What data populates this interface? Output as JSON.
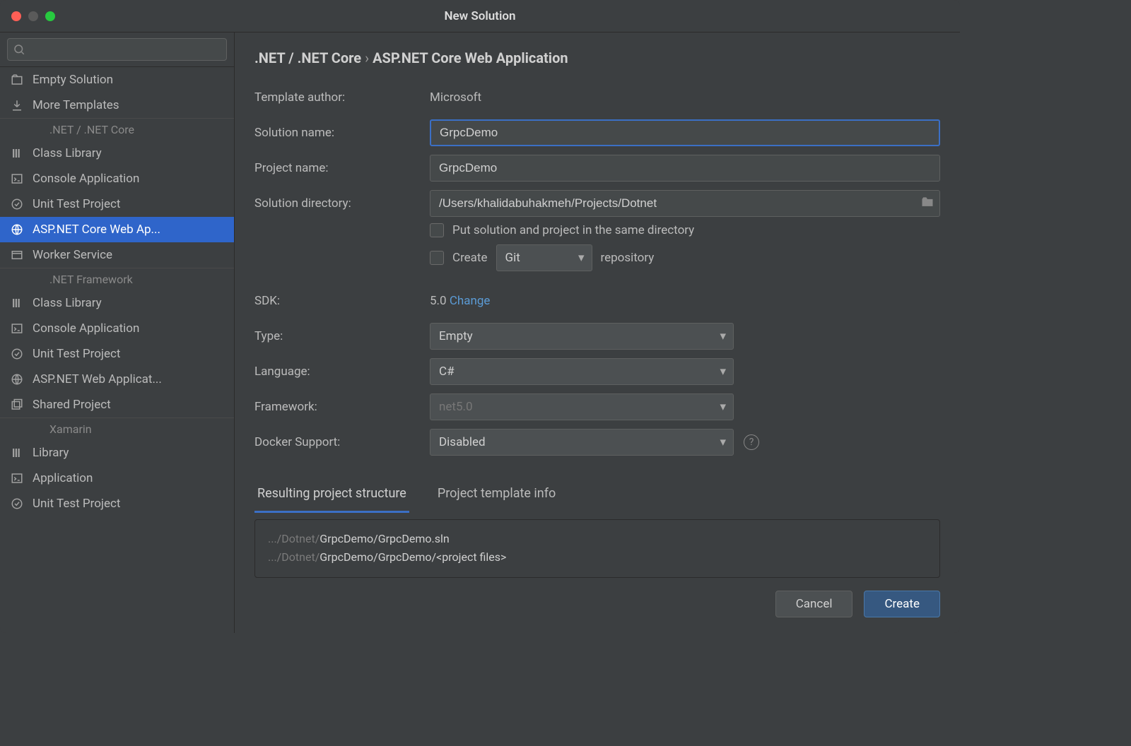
{
  "title": "New Solution",
  "search": {
    "placeholder": ""
  },
  "sidebar": {
    "top": [
      {
        "label": "Empty Solution",
        "icon": "empty-solution"
      },
      {
        "label": "More Templates",
        "icon": "download"
      }
    ],
    "sections": [
      {
        "name": ".NET / .NET Core",
        "items": [
          {
            "label": "Class Library",
            "icon": "library"
          },
          {
            "label": "Console Application",
            "icon": "console"
          },
          {
            "label": "Unit Test Project",
            "icon": "test"
          },
          {
            "label": "ASP.NET Core Web Ap...",
            "icon": "globe",
            "selected": true
          },
          {
            "label": "Worker Service",
            "icon": "window"
          }
        ]
      },
      {
        "name": ".NET Framework",
        "items": [
          {
            "label": "Class Library",
            "icon": "library"
          },
          {
            "label": "Console Application",
            "icon": "console"
          },
          {
            "label": "Unit Test Project",
            "icon": "test"
          },
          {
            "label": "ASP.NET Web Applicat...",
            "icon": "globe"
          },
          {
            "label": "Shared Project",
            "icon": "shared"
          }
        ]
      },
      {
        "name": "Xamarin",
        "items": [
          {
            "label": "Library",
            "icon": "library"
          },
          {
            "label": "Application",
            "icon": "console"
          },
          {
            "label": "Unit Test Project",
            "icon": "test"
          }
        ]
      }
    ]
  },
  "breadcrumb": {
    "section": ".NET / .NET Core",
    "page": "ASP.NET Core Web Application"
  },
  "form": {
    "template_author_label": "Template author:",
    "template_author": "Microsoft",
    "solution_name_label": "Solution name:",
    "solution_name": "GrpcDemo",
    "project_name_label": "Project name:",
    "project_name": "GrpcDemo",
    "solution_dir_label": "Solution directory:",
    "solution_dir": "/Users/khalidabuhakmeh/Projects/Dotnet",
    "same_dir_label": "Put solution and project in the same directory",
    "create_label": "Create",
    "git": "Git",
    "repo_label": "repository",
    "sdk_label": "SDK:",
    "sdk_value": "5.0",
    "sdk_change": "Change",
    "type_label": "Type:",
    "type_value": "Empty",
    "language_label": "Language:",
    "language_value": "C#",
    "framework_label": "Framework:",
    "framework_value": "net5.0",
    "docker_label": "Docker Support:",
    "docker_value": "Disabled"
  },
  "tabs": {
    "structure": "Resulting project structure",
    "info": "Project template info"
  },
  "structure": {
    "l1_muted": ".../Dotnet/",
    "l1_bright": "GrpcDemo/GrpcDemo.sln",
    "l2_muted": ".../Dotnet/",
    "l2_bright": "GrpcDemo/GrpcDemo/<project files>"
  },
  "buttons": {
    "cancel": "Cancel",
    "create": "Create"
  }
}
